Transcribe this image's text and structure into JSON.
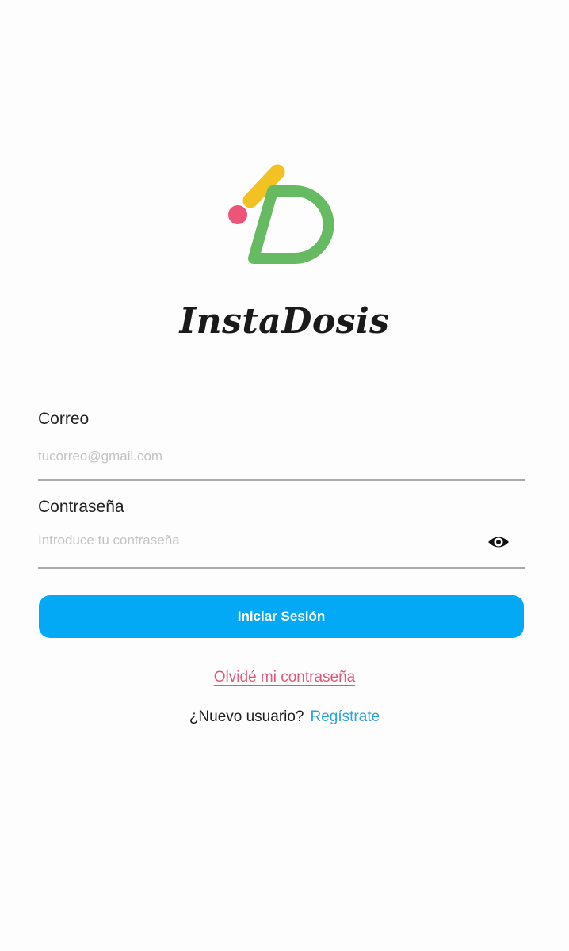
{
  "app": {
    "name": "InstaDosis"
  },
  "brand": {
    "logo_colors": {
      "green": "#66bb62",
      "yellow": "#f2c122",
      "pink": "#ee5477"
    }
  },
  "form": {
    "email": {
      "label": "Correo",
      "placeholder": "tucorreo@gmail.com",
      "value": ""
    },
    "password": {
      "label": "Contraseña",
      "placeholder": "Introduce tu contraseña",
      "value": "",
      "toggle_icon": "eye-icon"
    },
    "submit_label": "Iniciar Sesión"
  },
  "links": {
    "forgot_password": "Olvidé mi contraseña",
    "new_user_prompt": "¿Nuevo usuario?",
    "register": "Regístrate"
  },
  "colors": {
    "primary": "#03a9f4",
    "link_pink": "#e35878",
    "link_blue": "#29a3dd"
  }
}
